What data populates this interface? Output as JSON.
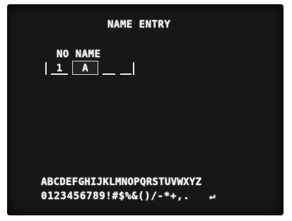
{
  "screen": {
    "title": "NAME ENTRY",
    "field_label": "NO NAME",
    "entry": {
      "number": "1",
      "chars": [
        "A",
        "",
        ""
      ]
    },
    "keyboard": {
      "letters_row": "ABCDEFGHIJKLMNOPQRSTUVWXYZ",
      "symbols_row": "0123456789!#$%&()/-*+,.",
      "enter_key": "↵"
    }
  }
}
